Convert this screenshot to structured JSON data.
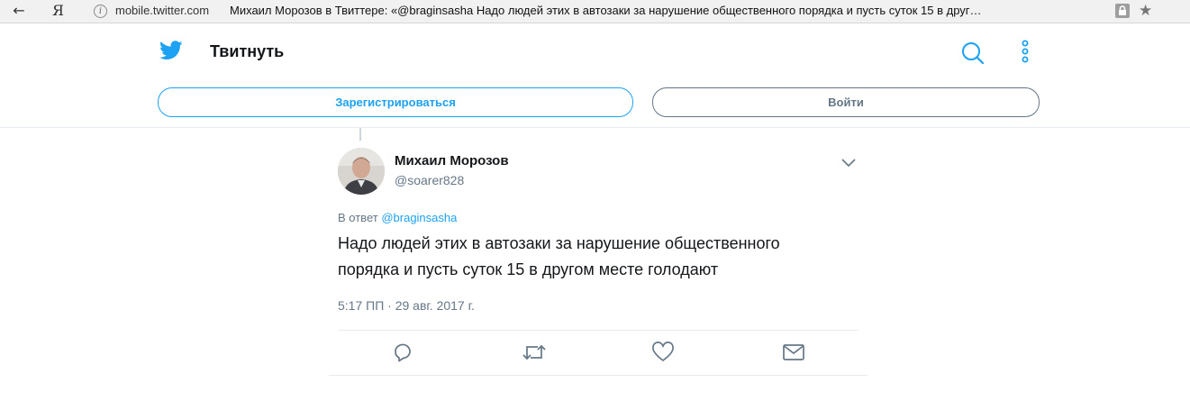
{
  "browser": {
    "back_glyph": "←",
    "yandex_logo": "Я",
    "info_glyph": "i",
    "url_host": "mobile.twitter.com",
    "page_title": "Михаил Морозов в Твиттере: «@braginsasha Надо людей этих в автозаки за нарушение общественного порядка и пусть суток 15 в друг…",
    "star_glyph": "★"
  },
  "header": {
    "title": "Твитнуть",
    "signup_label": "Зарегистрироваться",
    "login_label": "Войти"
  },
  "tweet": {
    "author_name": "Михаил Морозов",
    "author_handle": "@soarer828",
    "reply_prefix": "В ответ",
    "reply_to": "@braginsasha",
    "text": "Надо людей этих в автозаки за нарушение общественного порядка и пусть суток 15 в другом месте голодают",
    "timestamp": "5:17 ПП · 29 авг. 2017 г."
  },
  "colors": {
    "accent": "#1da1f2",
    "secondary_text": "#657786",
    "border": "#e6ecf0"
  },
  "icons": [
    "back-arrow-icon",
    "twitter-bird-icon",
    "search-icon",
    "more-vertical-icon",
    "caret-down-icon",
    "reply-icon",
    "retweet-icon",
    "like-icon",
    "message-icon",
    "lock-icon",
    "star-icon"
  ]
}
